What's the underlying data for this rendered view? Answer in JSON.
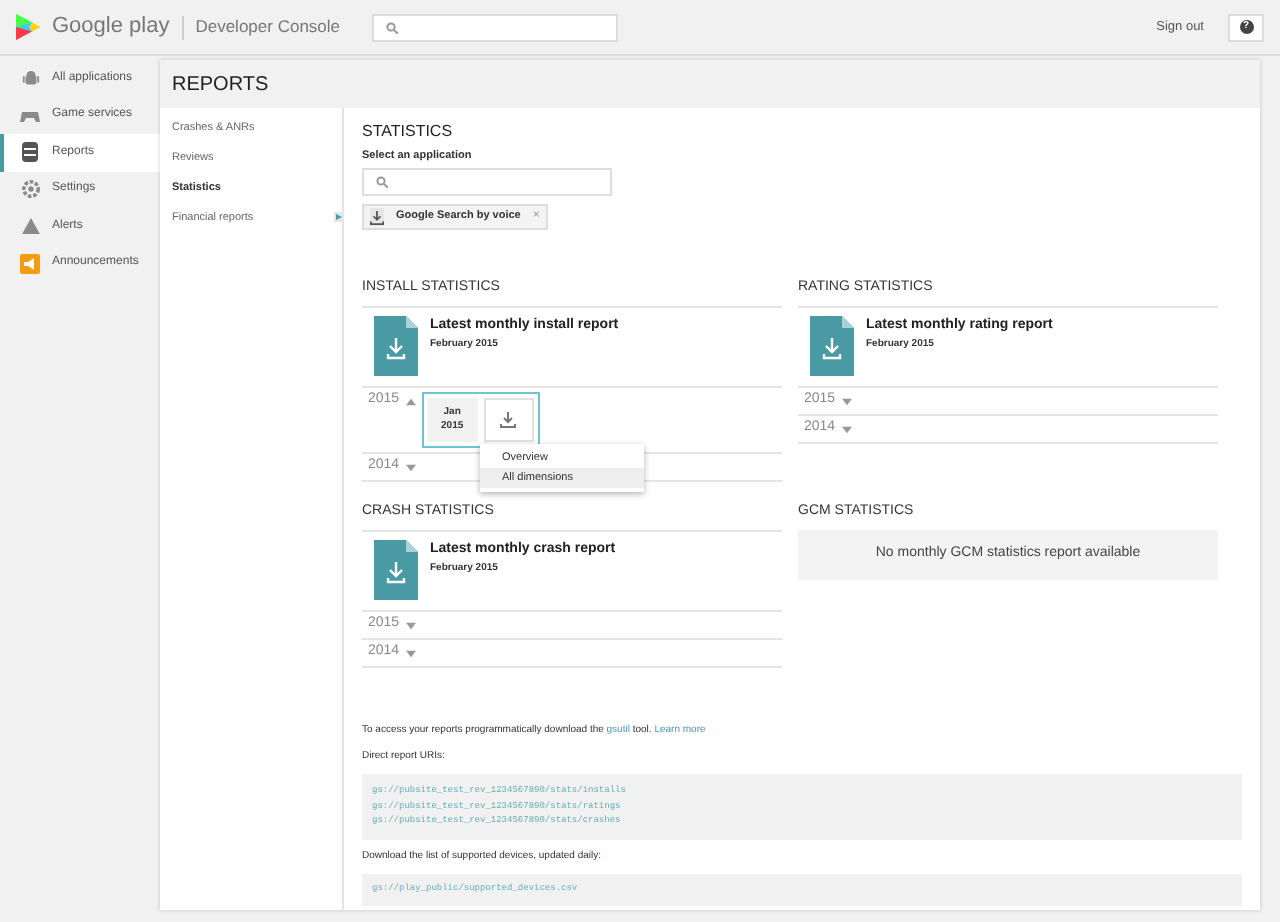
{
  "header": {
    "brand": "Google play",
    "product": "Developer Console",
    "sign_out": "Sign out",
    "help": "?"
  },
  "nav": [
    {
      "label": "All applications",
      "kind": "android",
      "selected": false
    },
    {
      "label": "Game services",
      "kind": "gamepad",
      "selected": false
    },
    {
      "label": "Reports",
      "kind": "database",
      "selected": true
    },
    {
      "label": "Settings",
      "kind": "gear",
      "selected": false
    },
    {
      "label": "Alerts",
      "kind": "alert",
      "selected": false
    },
    {
      "label": "Announcements",
      "kind": "megaphone",
      "selected": false
    }
  ],
  "page_title": "REPORTS",
  "subnav": [
    {
      "label": "Crashes & ANRs",
      "selected": false
    },
    {
      "label": "Reviews",
      "selected": false
    },
    {
      "label": "Statistics",
      "selected": true
    },
    {
      "label": "Financial reports",
      "selected": false
    }
  ],
  "statistics": {
    "title": "STATISTICS",
    "select_label": "Select an application",
    "chip": {
      "label": "Google Search by voice",
      "remove": "×"
    }
  },
  "sections": [
    {
      "kind": "report",
      "title": "INSTALL STATISTICS",
      "report_title": "Latest monthly install report",
      "report_date": "February 2015",
      "years": [
        {
          "year": "2015",
          "expanded": true,
          "months": [
            {
              "month": "Jan",
              "year": "2015"
            }
          ],
          "menu": [
            {
              "label": "Overview",
              "selected": false
            },
            {
              "label": "All dimensions",
              "selected": true
            }
          ]
        },
        {
          "year": "2014",
          "expanded": false
        }
      ]
    },
    {
      "kind": "report",
      "title": "RATING STATISTICS",
      "report_title": "Latest monthly rating report",
      "report_date": "February 2015",
      "years": [
        {
          "year": "2015",
          "expanded": false
        },
        {
          "year": "2014",
          "expanded": false
        }
      ]
    },
    {
      "kind": "report",
      "title": "CRASH STATISTICS",
      "report_title": "Latest monthly crash report",
      "report_date": "February 2015",
      "years": [
        {
          "year": "2015",
          "expanded": false
        },
        {
          "year": "2014",
          "expanded": false
        }
      ]
    },
    {
      "kind": "empty",
      "title": "GCM STATISTICS",
      "message": "No monthly GCM statistics report available"
    }
  ],
  "access": {
    "before": "To access your reports programmatically download the",
    "link": "gsutil",
    "after": "tool.",
    "learn_more": "Learn more"
  },
  "uris_label": "Direct report URIs:",
  "uris": [
    "gs://pubsite_test_rev_1234567890/stats/installs",
    "gs://pubsite_test_rev_1234567890/stats/ratings",
    "gs://pubsite_test_rev_1234567890/stats/crashes"
  ],
  "devices_label": "Download the list of supported devices, updated daily:",
  "devices_uri": "gs://play_public/supported_devices.csv"
}
